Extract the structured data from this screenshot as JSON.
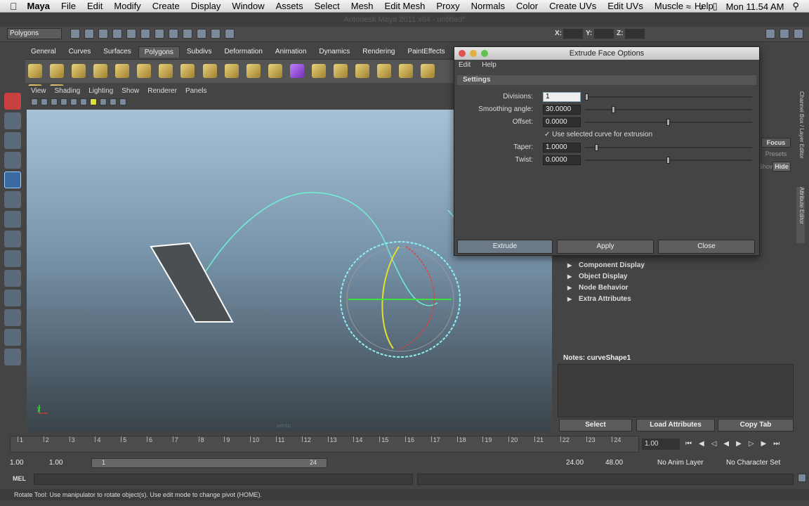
{
  "menubar": {
    "app": "Maya",
    "items": [
      "File",
      "Edit",
      "Modify",
      "Create",
      "Display",
      "Window",
      "Assets",
      "Select",
      "Mesh",
      "Edit Mesh",
      "Proxy",
      "Normals",
      "Color",
      "Create UVs",
      "Edit UVs",
      "Muscle",
      "Help"
    ],
    "clock": "Mon 11.54 AM"
  },
  "titlebar": "Autodesk Maya 2011 x64 - untitled*",
  "statusline": {
    "mode": "Polygons",
    "x_label": "X:",
    "y_label": "Y:",
    "z_label": "Z:"
  },
  "shelf": {
    "tabs": [
      "General",
      "Curves",
      "Surfaces",
      "Polygons",
      "Subdivs",
      "Deformation",
      "Animation",
      "Dynamics",
      "Rendering",
      "PaintEffects"
    ],
    "active": "Polygons"
  },
  "viewport": {
    "menu": [
      "View",
      "Shading",
      "Lighting",
      "Show",
      "Renderer",
      "Panels"
    ],
    "camera": "persp",
    "axis_y": "y"
  },
  "dialog": {
    "title": "Extrude Face Options",
    "menu": [
      "Edit",
      "Help"
    ],
    "section": "Settings",
    "fields": {
      "divisions": {
        "label": "Divisions:",
        "value": "1"
      },
      "smoothing": {
        "label": "Smoothing angle:",
        "value": "30.0000"
      },
      "offset": {
        "label": "Offset:",
        "value": "0.0000"
      },
      "use_curve": {
        "label": "Use selected curve for extrusion",
        "checked": true
      },
      "taper": {
        "label": "Taper:",
        "value": "1.0000"
      },
      "twist": {
        "label": "Twist:",
        "value": "0.0000"
      }
    },
    "buttons": {
      "extrude": "Extrude",
      "apply": "Apply",
      "close": "Close"
    }
  },
  "attribute_editor": {
    "sections": [
      "Component Display",
      "Object Display",
      "Node Behavior",
      "Extra Attributes"
    ],
    "focus": "Focus",
    "presets": "Presets",
    "show": "Show",
    "hide": "Hide",
    "notes": "Notes: curveShape1",
    "buttons": {
      "select": "Select",
      "load": "Load Attributes",
      "copy": "Copy Tab"
    },
    "side_tabs": {
      "channel": "Channel Box / Layer Editor",
      "attr": "Attribute Editor"
    }
  },
  "timeline": {
    "ticks": [
      "1",
      "2",
      "3",
      "4",
      "5",
      "6",
      "7",
      "8",
      "9",
      "10",
      "11",
      "12",
      "13",
      "14",
      "15",
      "16",
      "17",
      "18",
      "19",
      "20",
      "21",
      "22",
      "23",
      "24"
    ],
    "current": "1.00"
  },
  "range": {
    "start": "1.00",
    "start2": "1.00",
    "range_start": "1",
    "range_end": "24",
    "end": "24.00",
    "end2": "48.00",
    "anim_layer": "No Anim Layer",
    "char_set": "No Character Set"
  },
  "cmdline": {
    "label": "MEL"
  },
  "helpline": "Rotate Tool: Use manipulator to rotate object(s). Use edit mode to change pivot (HOME)."
}
